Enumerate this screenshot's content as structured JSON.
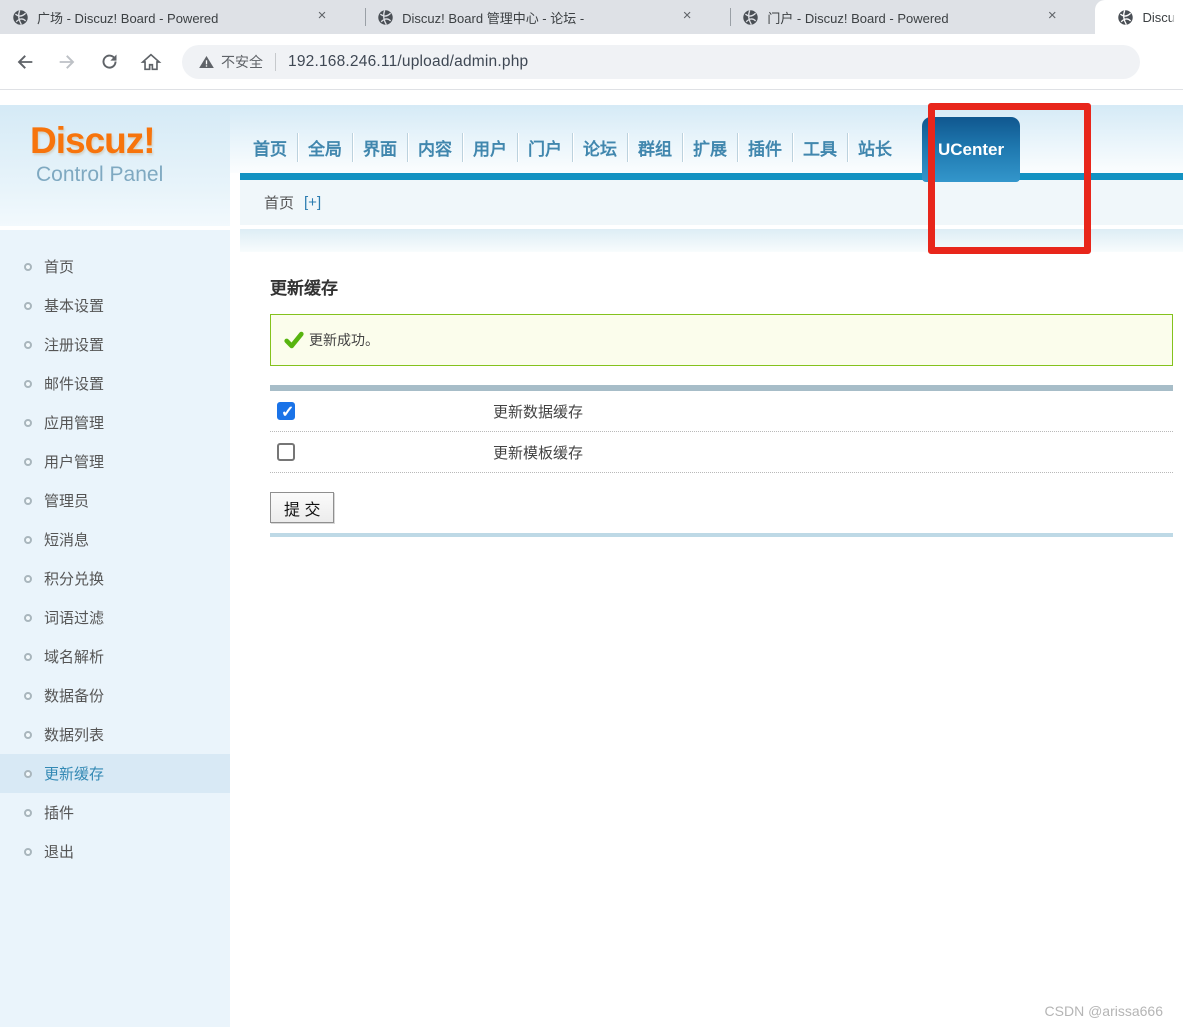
{
  "browser": {
    "tabs": [
      {
        "title": "广场 - Discuz! Board - Powered",
        "close": "×"
      },
      {
        "title": "Discuz! Board 管理中心 - 论坛 -",
        "close": "×"
      },
      {
        "title": "门户 - Discuz! Board - Powered",
        "close": "×"
      },
      {
        "title": "Discu",
        "close": ""
      }
    ],
    "security_label": "不安全",
    "url": "192.168.246.11/upload/admin.php"
  },
  "header": {
    "logo_title": "Discuz!",
    "logo_subtitle": "Control Panel",
    "nav": [
      "首页",
      "全局",
      "界面",
      "内容",
      "用户",
      "门户",
      "论坛",
      "群组",
      "扩展",
      "插件",
      "工具",
      "站长"
    ],
    "ucenter_label": "UCenter"
  },
  "breadcrumb": {
    "home": "首页",
    "expand": "[+]"
  },
  "sidebar": {
    "items": [
      {
        "label": "首页",
        "active": false
      },
      {
        "label": "基本设置",
        "active": false
      },
      {
        "label": "注册设置",
        "active": false
      },
      {
        "label": "邮件设置",
        "active": false
      },
      {
        "label": "应用管理",
        "active": false
      },
      {
        "label": "用户管理",
        "active": false
      },
      {
        "label": "管理员",
        "active": false
      },
      {
        "label": "短消息",
        "active": false
      },
      {
        "label": "积分兑换",
        "active": false
      },
      {
        "label": "词语过滤",
        "active": false
      },
      {
        "label": "域名解析",
        "active": false
      },
      {
        "label": "数据备份",
        "active": false
      },
      {
        "label": "数据列表",
        "active": false
      },
      {
        "label": "更新缓存",
        "active": true
      },
      {
        "label": "插件",
        "active": false
      },
      {
        "label": "退出",
        "active": false
      }
    ]
  },
  "main": {
    "title": "更新缓存",
    "success_message": "更新成功。",
    "rows": [
      {
        "label": "更新数据缓存",
        "checked": true
      },
      {
        "label": "更新模板缓存",
        "checked": false
      }
    ],
    "submit_label": "提 交"
  },
  "watermark": "CSDN @arissa666",
  "colors": {
    "accent_teal": "#1392c2",
    "nav_blue": "#4187ae",
    "ucenter_gradient_top": "#10578f",
    "ucenter_gradient_bottom": "#3396cb",
    "logo_orange": "#f7740c",
    "success_border": "#84c21d",
    "success_bg": "#fbfdec",
    "checkbox_checked": "#1a73e8",
    "annotation_red": "#e8261b",
    "sidebar_bg": "#eaf4fb",
    "sidebar_active_bg": "#d8e9f5"
  }
}
